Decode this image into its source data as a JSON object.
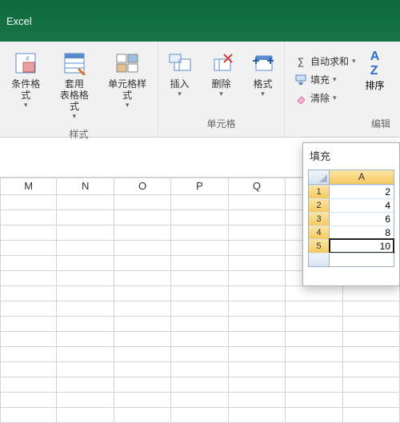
{
  "title": "Excel",
  "ribbon": {
    "styles": {
      "cond": "条件格式",
      "table": "套用\n表格格式",
      "cell": "单元格样式",
      "group": "样式"
    },
    "cells": {
      "insert": "插入",
      "delete": "删除",
      "format": "格式",
      "group": "单元格"
    },
    "editing": {
      "sum": "自动求和",
      "fill": "填充",
      "clear": "清除",
      "sort": "排序",
      "group": "编辑"
    }
  },
  "columns": [
    "M",
    "N",
    "O",
    "P",
    "Q"
  ],
  "popup": {
    "title": "填充",
    "colA": "A",
    "rows": [
      {
        "n": "1",
        "v": "2"
      },
      {
        "n": "2",
        "v": "4"
      },
      {
        "n": "3",
        "v": "6"
      },
      {
        "n": "4",
        "v": "8"
      },
      {
        "n": "5",
        "v": "10"
      }
    ]
  },
  "chart_data": {
    "type": "table",
    "title": "填充",
    "categories": [
      "A"
    ],
    "series": [
      {
        "name": "A",
        "values": [
          2,
          4,
          6,
          8,
          10
        ]
      }
    ]
  }
}
